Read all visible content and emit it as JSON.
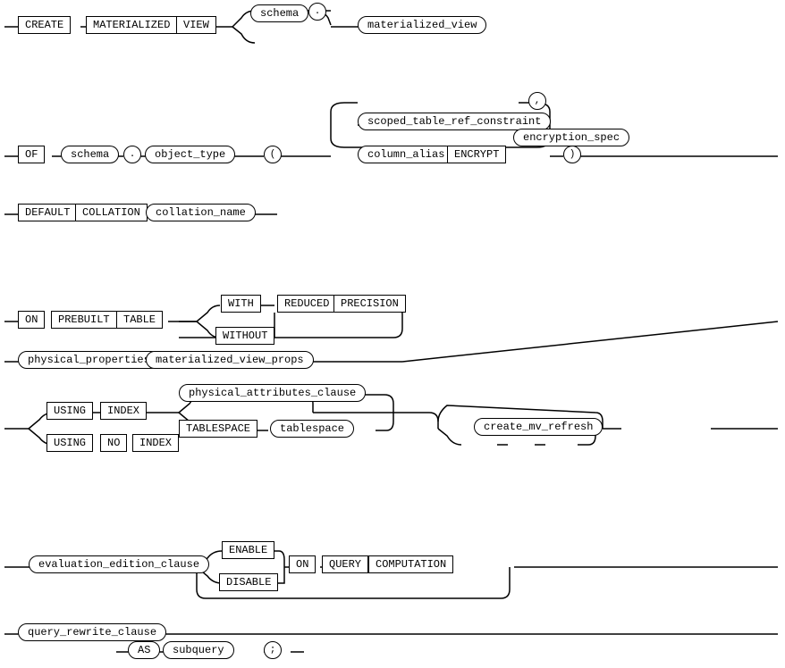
{
  "nodes": {
    "row1": {
      "create": "CREATE",
      "materialized": "MATERIALIZED",
      "view": "VIEW",
      "schema": "schema",
      "dot1": ".",
      "materialized_view": "materialized_view"
    },
    "row2": {
      "of": "OF",
      "schema2": "schema",
      "dot2": ".",
      "object_type": "object_type",
      "lparen": "(",
      "comma": ",",
      "scoped_table_ref": "scoped_table_ref_constraint",
      "column_alias": "column_alias",
      "encrypt": "ENCRYPT",
      "encryption_spec": "encryption_spec",
      "rparen": ")"
    },
    "row3": {
      "default": "DEFAULT",
      "collation": "COLLATION",
      "collation_name": "collation_name"
    },
    "row4": {
      "on": "ON",
      "prebuilt": "PREBUILT",
      "table": "TABLE",
      "with": "WITH",
      "without": "WITHOUT",
      "reduced": "REDUCED",
      "precision": "PRECISION",
      "physical_properties": "physical_properties",
      "materialized_view_props": "materialized_view_props"
    },
    "row5": {
      "using": "USING",
      "index": "INDEX",
      "using2": "USING",
      "no": "NO",
      "index2": "INDEX",
      "physical_attributes_clause": "physical_attributes_clause",
      "tablespace_kw": "TABLESPACE",
      "tablespace": "tablespace",
      "create_mv_refresh": "create_mv_refresh"
    },
    "row6": {
      "evaluation_edition_clause": "evaluation_edition_clause",
      "enable": "ENABLE",
      "disable": "DISABLE",
      "on": "ON",
      "query": "QUERY",
      "computation": "COMPUTATION"
    },
    "row7": {
      "query_rewrite_clause": "query_rewrite_clause",
      "as": "AS",
      "subquery": "subquery",
      "semicolon": ";"
    }
  }
}
